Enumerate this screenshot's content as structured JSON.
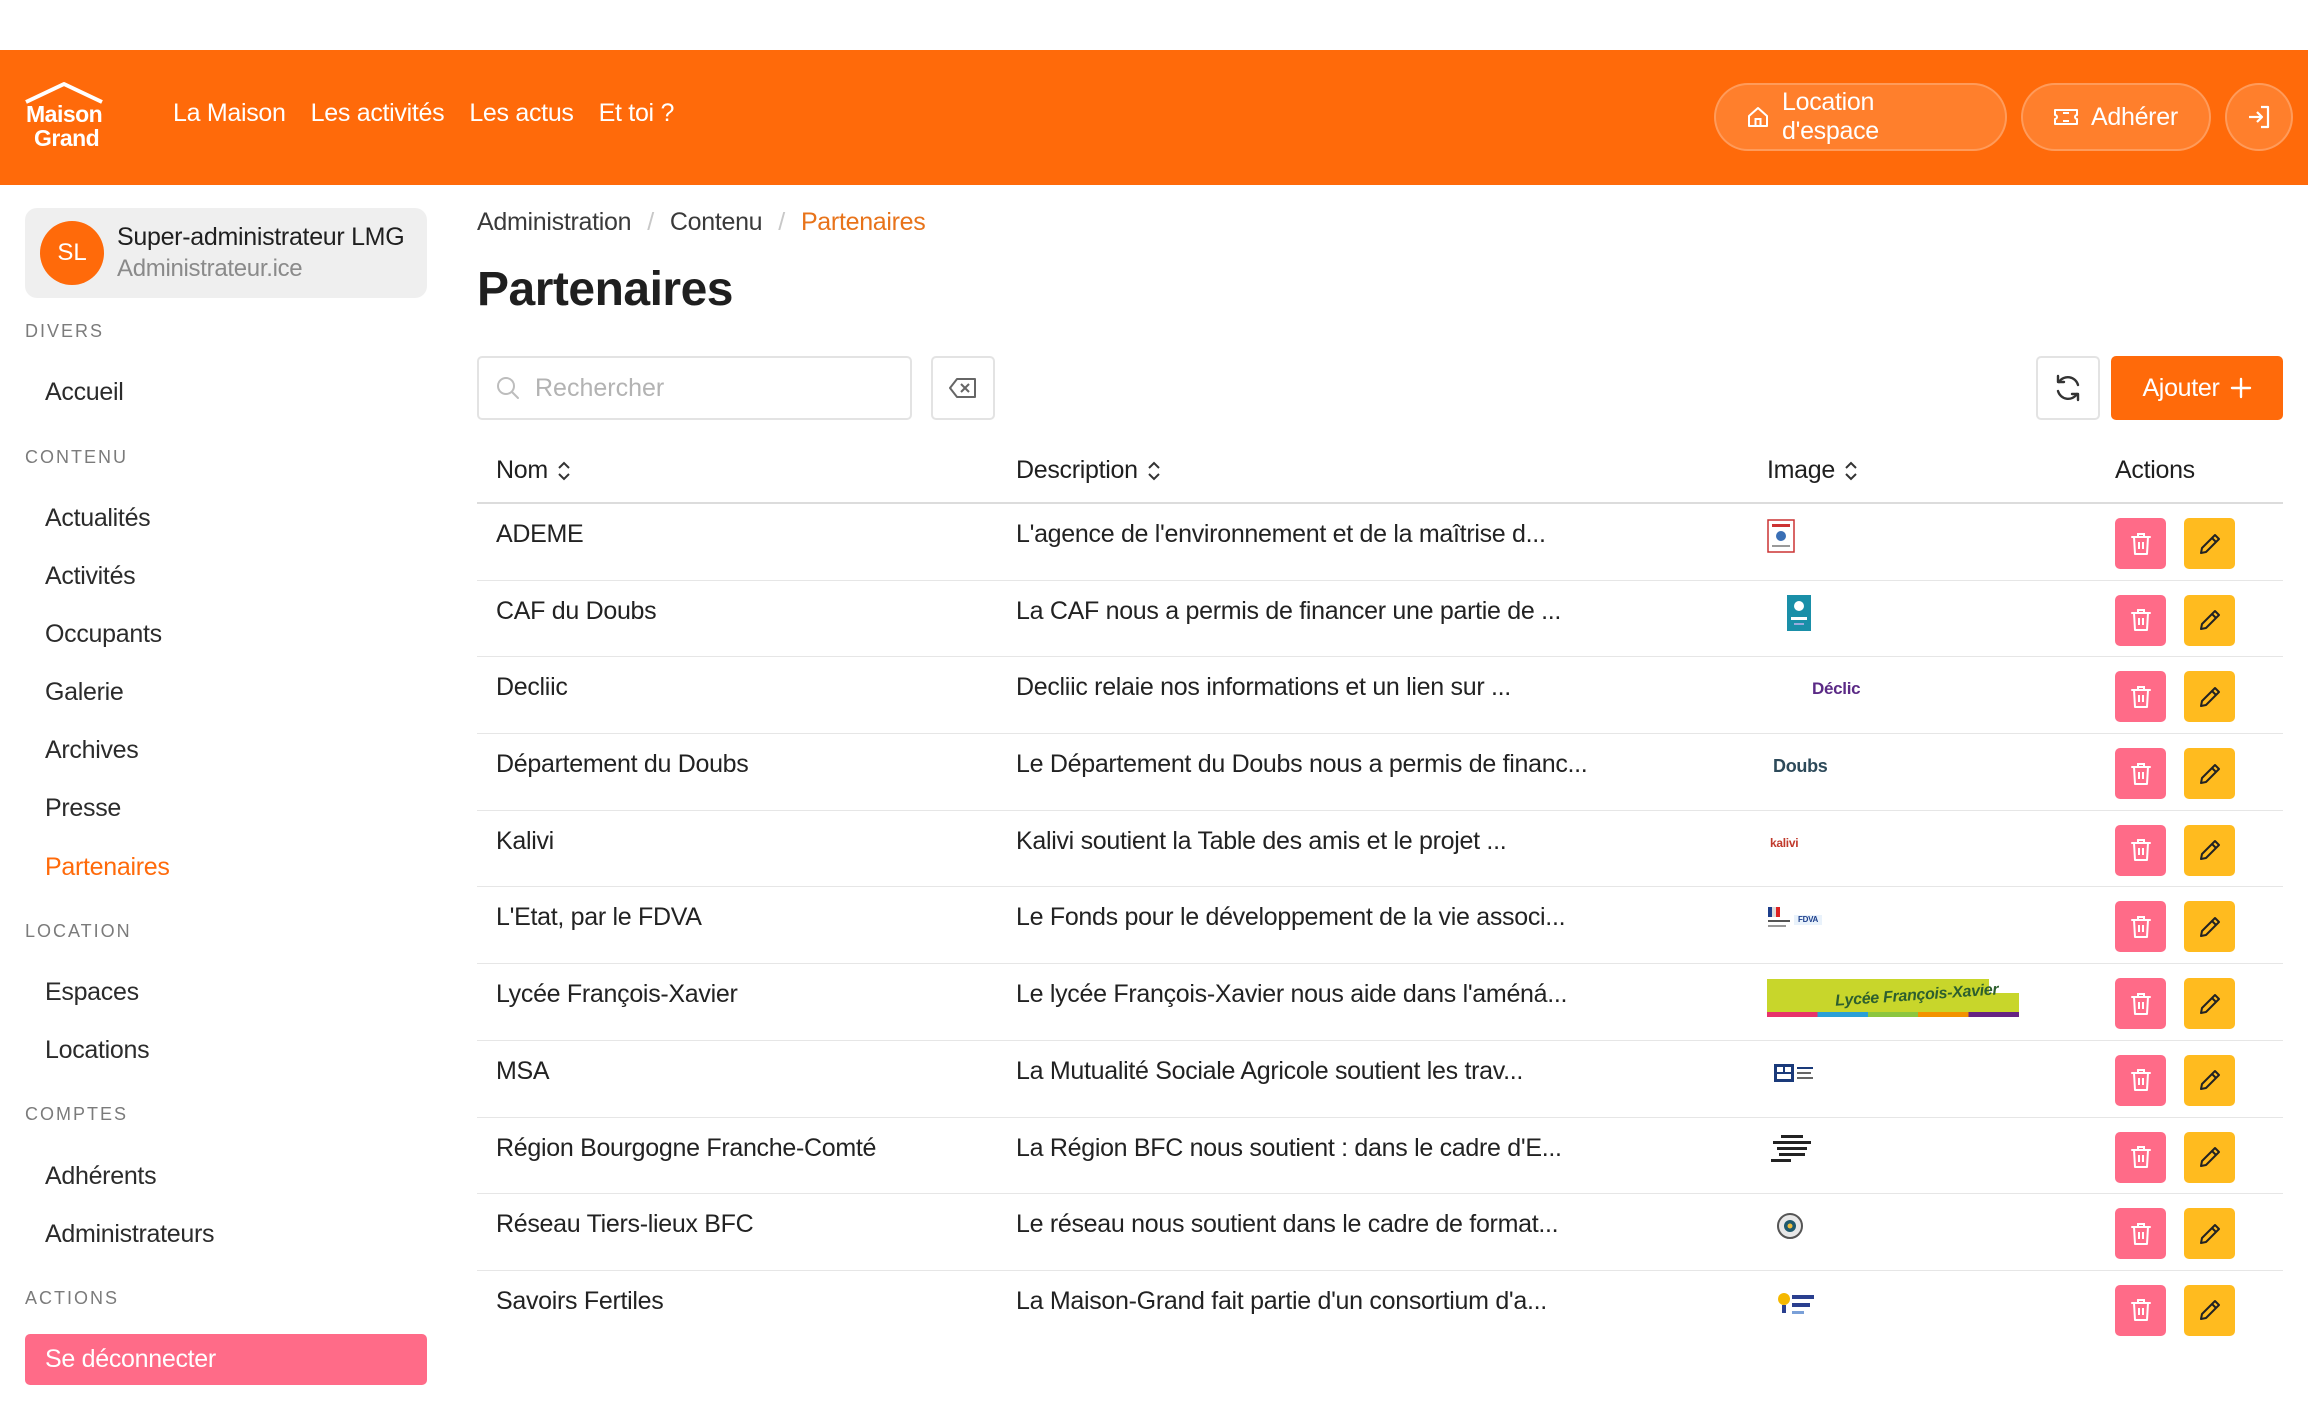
{
  "header": {
    "logo": {
      "line1": "Maison",
      "line2": "Grand"
    },
    "nav": [
      "La Maison",
      "Les activités",
      "Les actus",
      "Et toi ?"
    ],
    "location_label": "Location d'espace",
    "adherer_label": "Adhérer"
  },
  "sidebar": {
    "user": {
      "initials": "SL",
      "name": "Super-administrateur LMG",
      "role": "Administrateur.ice"
    },
    "sections": {
      "divers": "DIVERS",
      "contenu": "CONTENU",
      "location": "LOCATION",
      "comptes": "COMPTES",
      "actions": "ACTIONS"
    },
    "items": {
      "accueil": "Accueil",
      "actualites": "Actualités",
      "activites": "Activités",
      "occupants": "Occupants",
      "galerie": "Galerie",
      "archives": "Archives",
      "presse": "Presse",
      "partenaires": "Partenaires",
      "espaces": "Espaces",
      "locations": "Locations",
      "adherents": "Adhérents",
      "administrateurs": "Administrateurs"
    },
    "logout_label": "Se déconnecter"
  },
  "breadcrumb": [
    "Administration",
    "Contenu",
    "Partenaires"
  ],
  "page_title": "Partenaires",
  "search": {
    "placeholder": "Rechercher",
    "value": ""
  },
  "add_label": "Ajouter",
  "table": {
    "headers": {
      "nom": "Nom",
      "description": "Description",
      "image": "Image",
      "actions": "Actions"
    },
    "rows": [
      {
        "nom": "ADEME",
        "description": "L'agence de l'environnement et de la maîtrise d...",
        "image": "ademe-logo"
      },
      {
        "nom": "CAF du Doubs",
        "description": "La CAF nous a permis de financer une partie de ...",
        "image": "caf-logo"
      },
      {
        "nom": "Decliic",
        "description": "Decliic relaie nos informations et un lien sur ...",
        "image": "decliic-logo"
      },
      {
        "nom": "Département du Doubs",
        "description": "Le Département du Doubs nous a permis de financ...",
        "image": "doubs-logo"
      },
      {
        "nom": "Kalivi",
        "description": "Kalivi soutient la Table des amis et le projet ...",
        "image": "kalivi-logo"
      },
      {
        "nom": "L'Etat, par le FDVA",
        "description": "Le Fonds pour le développement de la vie associ...",
        "image": "fdva-logo"
      },
      {
        "nom": "Lycée François-Xavier",
        "description": "Le lycée François-Xavier nous aide dans l'améná...",
        "image": "lycee-fx-banner"
      },
      {
        "nom": "MSA",
        "description": "La Mutualité Sociale Agricole soutient les trav...",
        "image": "msa-logo"
      },
      {
        "nom": "Région Bourgogne Franche-Comté",
        "description": "La Région BFC nous soutient : dans le cadre d'E...",
        "image": "region-bfc-logo"
      },
      {
        "nom": "Réseau Tiers-lieux BFC",
        "description": "Le réseau nous soutient dans le cadre de format...",
        "image": "reseau-tiers-lieux-logo"
      },
      {
        "nom": "Savoirs Fertiles",
        "description": "La Maison-Grand fait partie d'un consortium d'a...",
        "image": "savoirs-fertiles-logo"
      }
    ]
  },
  "logos": {
    "decliic": "Déclic",
    "doubs": "Doubs",
    "kalivi": "kalivi",
    "fdva": "FDVA",
    "lycee": "Lycée François-Xavier"
  },
  "colors": {
    "brand": "#ff6a0a",
    "danger": "#ff6b88",
    "warning": "#ffbb1f"
  }
}
